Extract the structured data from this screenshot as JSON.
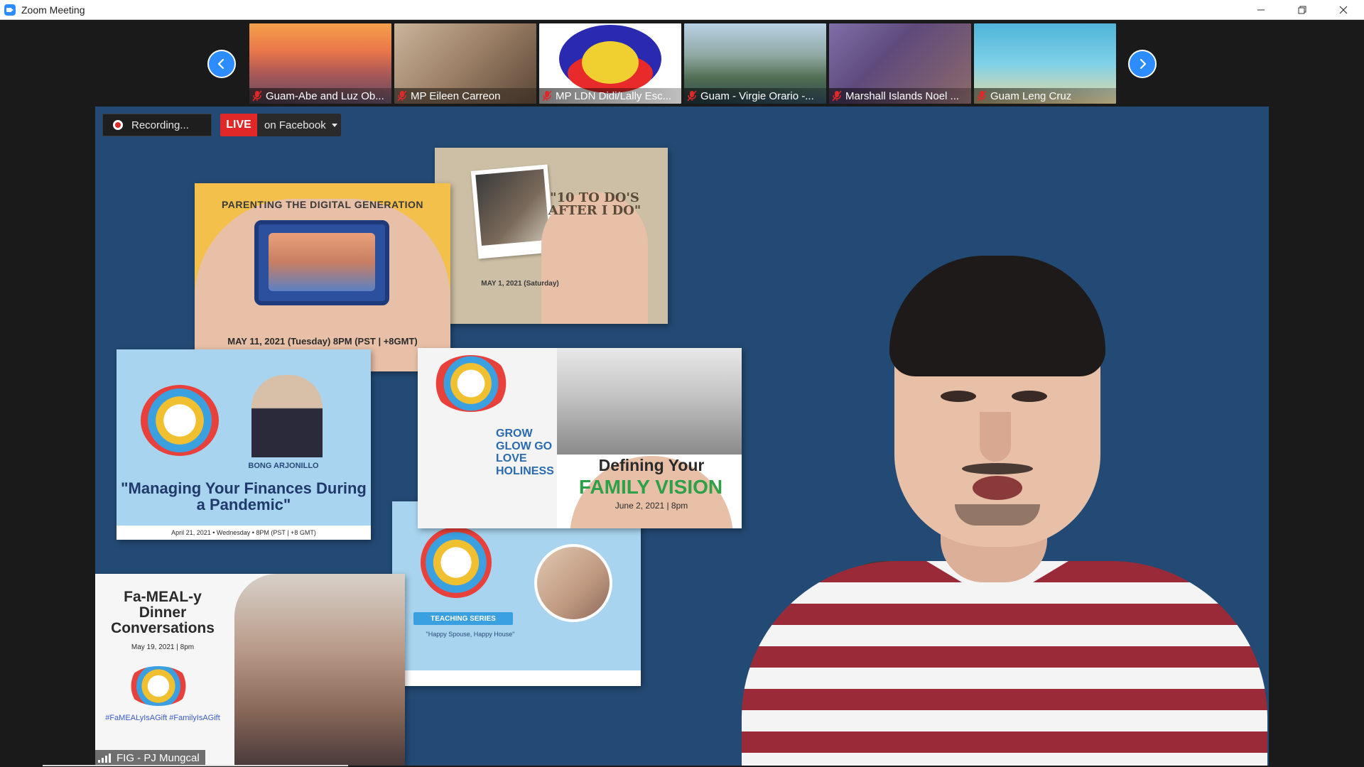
{
  "window": {
    "title": "Zoom Meeting",
    "controls": {
      "minimize_icon": "minimize-icon",
      "restore_icon": "restore-icon",
      "close_icon": "close-icon"
    }
  },
  "filmstrip": {
    "prev_icon": "chevron-left-icon",
    "next_icon": "chevron-right-icon",
    "participants": [
      {
        "name": "Guam-Abe and Luz Ob...",
        "muted": true
      },
      {
        "name": "MP Eileen Carreon",
        "muted": true
      },
      {
        "name": "MP LDN Didi/Lally Esc...",
        "muted": true
      },
      {
        "name": "Guam - Virgie Orario -...",
        "muted": true
      },
      {
        "name": "Marshall Islands Noel ...",
        "muted": true
      },
      {
        "name": "Guam Leng Cruz",
        "muted": true
      }
    ]
  },
  "main_video": {
    "recording_label": "Recording...",
    "live_label": "LIVE",
    "live_destination": "on Facebook",
    "speaker_name": "FIG - PJ Mungcal",
    "posters": {
      "parenting_title": "PARENTING THE DIGITAL GENERATION",
      "parenting_date": "MAY 11, 2021 (Tuesday) 8PM (PST | +8GMT)",
      "todo_title": "\"10 TO DO'S AFTER I DO\"",
      "todo_date": "MAY 1, 2021 (Saturday)",
      "finances_speaker": "BONG ARJONILLO",
      "finances_title": "\"Managing Your Finances During a Pandemic\"",
      "finances_footer": "April 21, 2021 • Wednesday • 8PM (PST | +8 GMT)",
      "vision_title": "Defining Your",
      "vision_title2": "FAMILY VISION",
      "vision_date": "June 2, 2021 | 8pm",
      "vision_grow": "GROW GLOW GO LOVE HOLINESS",
      "teaching_tag": "TEACHING SERIES",
      "teaching_sub": "\"Happy Spouse, Happy House\"",
      "meal_title": "Fa-MEAL-y Dinner Conversations",
      "meal_date": "May 19, 2021 | 8pm",
      "meal_tags": "#FaMEALyIsAGift #FamilyIsAGift"
    }
  }
}
